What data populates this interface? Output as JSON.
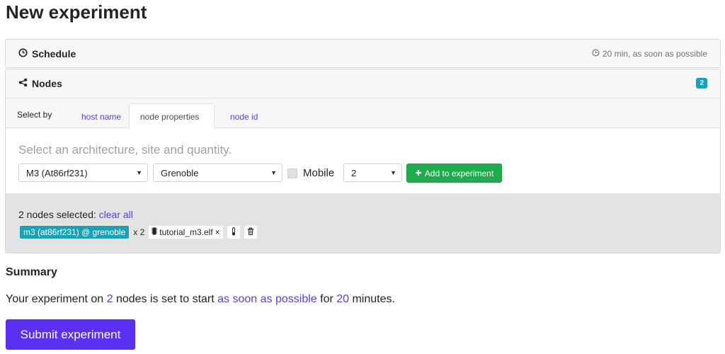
{
  "page": {
    "title": "New experiment"
  },
  "schedule": {
    "label": "Schedule",
    "info": "20 min, as soon as possible",
    "icon": "clock-icon"
  },
  "nodes": {
    "label": "Nodes",
    "count_badge": "2",
    "icon": "share-icon",
    "tabs": {
      "prefix": "Select by",
      "host_name": "host name",
      "node_properties": "node properties",
      "node_id": "node id",
      "active": "node properties"
    },
    "hint": "Select an architecture, site and quantity.",
    "architecture": "M3 (At86rf231)",
    "site": "Grenoble",
    "mobile_label": "Mobile",
    "mobile_checked": false,
    "quantity": "2",
    "add_button": "Add to experiment",
    "selection": {
      "summary": "2 nodes selected: ",
      "clear_all": "clear all",
      "node_chip": "m3 (at86rf231) @ grenoble",
      "multiplier": "x 2",
      "firmware": "tutorial_m3.elf",
      "firmware_remove": "×"
    }
  },
  "summary": {
    "title": "Summary",
    "part1": "Your experiment on ",
    "node_count": "2",
    "part2": " nodes is set to start ",
    "start": "as soon as possible",
    "part3": " for ",
    "duration": "20",
    "part4": " minutes."
  },
  "submit_button": "Submit experiment",
  "colors": {
    "accent": "#5a31f2",
    "link": "#5a3ee6",
    "success": "#1fac4c",
    "info": "#17a2b8"
  }
}
